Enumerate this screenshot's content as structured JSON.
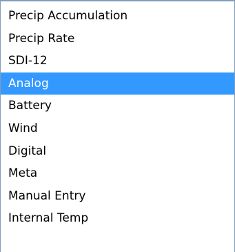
{
  "dropdown": {
    "selected_index": 3,
    "selected_value": "Analog",
    "options": [
      "Precip Accumulation",
      "Precip Rate",
      "SDI-12",
      "Analog",
      "Battery",
      "Wind",
      "Digital",
      "Meta",
      "Manual Entry",
      "Internal Temp"
    ]
  },
  "colors": {
    "selection_background": "#3399ff",
    "selection_text": "#ffffff",
    "border": "#7f9db9"
  }
}
